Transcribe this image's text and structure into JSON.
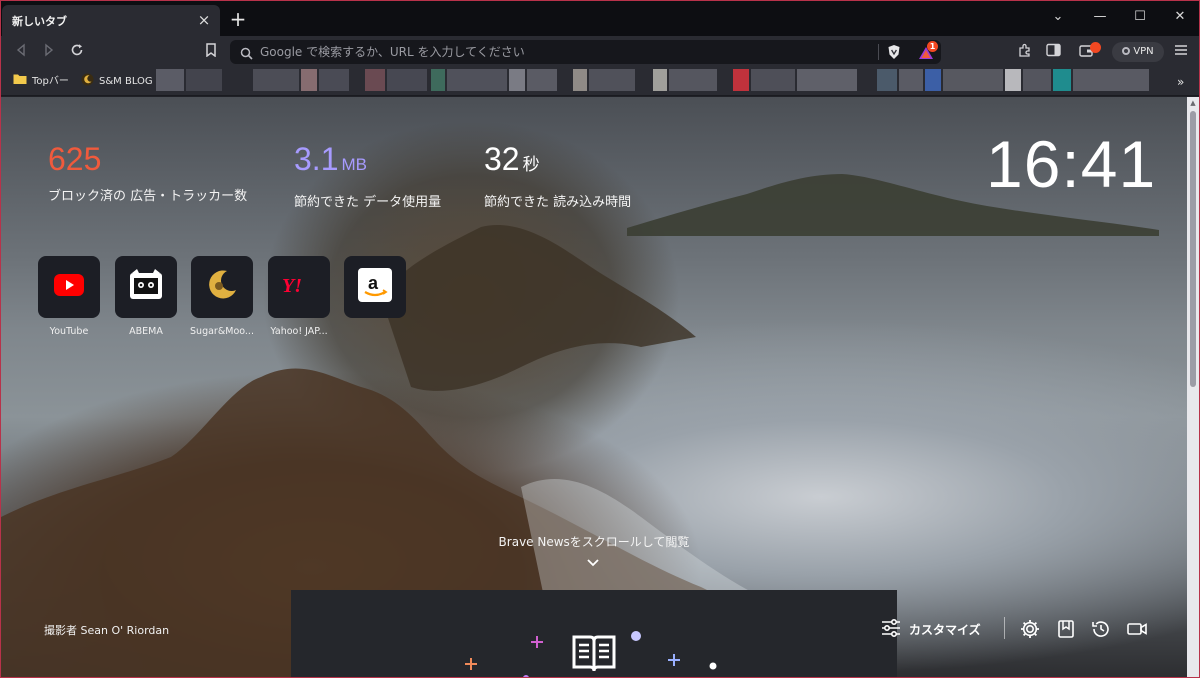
{
  "browser": {
    "tab_title": "新しいタブ",
    "tab_close": "×",
    "new_tab": "+",
    "window_controls": {
      "tabs_menu": "⌄",
      "minimize": "—",
      "maximize": "☐",
      "close": "✕"
    },
    "omnibox": {
      "placeholder": "Google で検索するか、URL を入力してください",
      "value": ""
    },
    "rewards_badge": "1",
    "vpn_label": "VPN",
    "bookmarks": [
      {
        "label": "Topバー",
        "icon": "folder-icon"
      },
      {
        "label": "S&M BLOG",
        "icon": "sugar-moon-icon"
      }
    ],
    "bookmarks_more": "»",
    "colors": {
      "accent": "#f24822",
      "frame": "#b8324a",
      "toolbar": "#2a2b32"
    }
  },
  "stats": {
    "ads": {
      "value": "625",
      "unit": "",
      "label": "ブロック済の 広告・トラッカー数",
      "color": "#f05a3c"
    },
    "data": {
      "value": "3.1",
      "unit": "MB",
      "label": "節約できた データ使用量",
      "color": "#a79bff"
    },
    "time": {
      "value": "32",
      "unit": "秒",
      "label": "節約できた 読み込み時間",
      "color": "#ffffff"
    }
  },
  "clock": "16:41",
  "top_sites": [
    {
      "label": "YouTube",
      "icon": "youtube-icon"
    },
    {
      "label": "ABEMA",
      "icon": "abema-icon"
    },
    {
      "label": "Sugar&Moo...",
      "icon": "sugar-moon-icon"
    },
    {
      "label": "Yahoo! JAP...",
      "icon": "yahoo-icon"
    },
    {
      "label": "",
      "icon": "amazon-icon"
    }
  ],
  "news_hint": "Brave Newsをスクロールして閲覧",
  "photo_credit": "撮影者 Sean O' Riordan",
  "customize_label": "カスタマイズ"
}
